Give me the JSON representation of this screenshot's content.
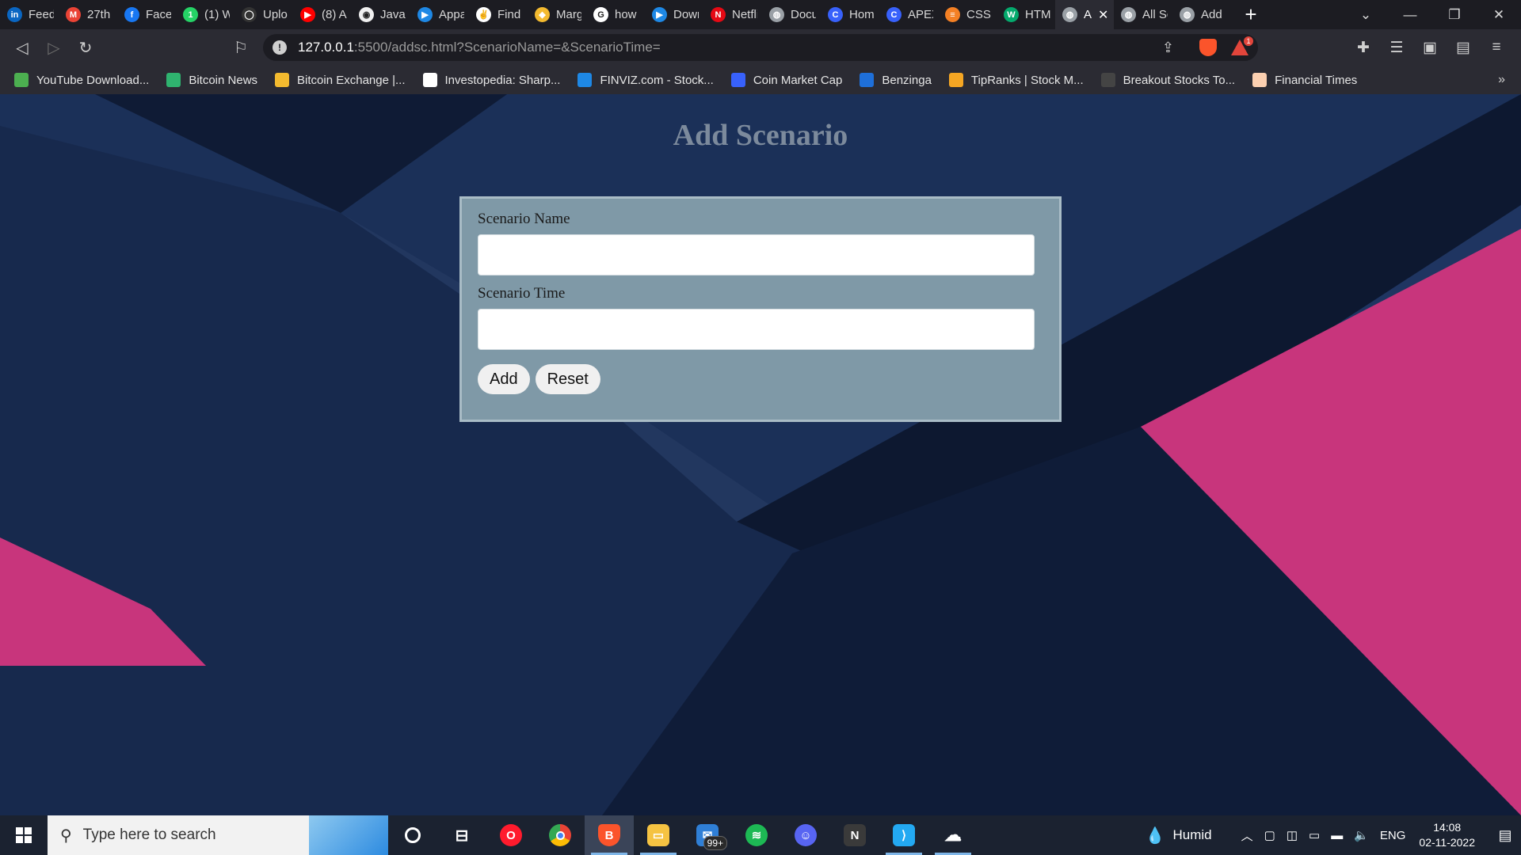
{
  "browser": {
    "tabs": [
      {
        "label": "Feed",
        "icon": "linkedin-icon",
        "color": "#0a66c2",
        "glyph": "in"
      },
      {
        "label": "27th",
        "icon": "gmail-icon",
        "color": "#ea4335",
        "glyph": "M"
      },
      {
        "label": "Faceb",
        "icon": "facebook-icon",
        "color": "#1877f2",
        "glyph": "f"
      },
      {
        "label": "(1) W",
        "icon": "whatsapp-icon",
        "color": "#25d366",
        "glyph": "1"
      },
      {
        "label": "Uplo",
        "icon": "github-icon",
        "color": "#333333",
        "glyph": "◯"
      },
      {
        "label": "(8) A",
        "icon": "youtube-icon",
        "color": "#ff0000",
        "glyph": "▶"
      },
      {
        "label": "JavaS",
        "icon": "github-icon",
        "color": "#f0f0f0",
        "glyph": "◉"
      },
      {
        "label": "Appa",
        "icon": "play-icon",
        "color": "#1e88e5",
        "glyph": "▶"
      },
      {
        "label": "Find",
        "icon": "angellist-icon",
        "color": "#ffffff",
        "glyph": "✌"
      },
      {
        "label": "Marg",
        "icon": "binance-icon",
        "color": "#f3ba2f",
        "glyph": "◆"
      },
      {
        "label": "how",
        "icon": "google-icon",
        "color": "#ffffff",
        "glyph": "G"
      },
      {
        "label": "Down",
        "icon": "play-icon",
        "color": "#1e88e5",
        "glyph": "▶"
      },
      {
        "label": "Netfli",
        "icon": "netflix-icon",
        "color": "#e50914",
        "glyph": "N"
      },
      {
        "label": "Docu",
        "icon": "globe-icon",
        "color": "#9aa0a6",
        "glyph": "◍"
      },
      {
        "label": "Hom",
        "icon": "coinmarketcap-icon",
        "color": "#3861fb",
        "glyph": "C"
      },
      {
        "label": "APEX",
        "icon": "coinmarketcap-icon",
        "color": "#3861fb",
        "glyph": "C"
      },
      {
        "label": "CSS f",
        "icon": "stackoverflow-icon",
        "color": "#f48024",
        "glyph": "≡"
      },
      {
        "label": "HTM",
        "icon": "w3schools-icon",
        "color": "#04aa6d",
        "glyph": "W"
      },
      {
        "label": "A",
        "icon": "globe-icon",
        "color": "#9aa0a6",
        "glyph": "◍",
        "active": true
      },
      {
        "label": "All Sc",
        "icon": "globe-icon",
        "color": "#9aa0a6",
        "glyph": "◍"
      },
      {
        "label": "Add",
        "icon": "globe-icon",
        "color": "#9aa0a6",
        "glyph": "◍"
      }
    ],
    "url_host": "127.0.0.1",
    "url_path": ":5500/addsc.html?ScenarioName=&ScenarioTime=",
    "bat_badge": "1",
    "bookmarks": [
      {
        "label": "YouTube Download...",
        "color": "#4caf50"
      },
      {
        "label": "Bitcoin News",
        "color": "#2fb36f"
      },
      {
        "label": "Bitcoin Exchange |...",
        "color": "#f3ba2f"
      },
      {
        "label": "Investopedia: Sharp...",
        "color": "#ffffff"
      },
      {
        "label": "FINVIZ.com - Stock...",
        "color": "#1e88e5"
      },
      {
        "label": "Coin Market Cap",
        "color": "#3861fb"
      },
      {
        "label": "Benzinga",
        "color": "#1e6fd9"
      },
      {
        "label": "TipRanks | Stock M...",
        "color": "#f5a623"
      },
      {
        "label": "Breakout Stocks To...",
        "color": "#444444"
      },
      {
        "label": "Financial Times",
        "color": "#fcd0b1"
      }
    ]
  },
  "page": {
    "title": "Add Scenario",
    "form": {
      "name_label": "Scenario Name",
      "name_value": "",
      "time_label": "Scenario Time",
      "time_value": "",
      "add_button": "Add",
      "reset_button": "Reset"
    },
    "colors": {
      "background": "#13223f",
      "accent_pink": "#c8357c",
      "panel": "#7f99a7"
    }
  },
  "taskbar": {
    "search_placeholder": "Type here to search",
    "mail_badge": "99+",
    "weather": "Humid",
    "language": "ENG",
    "time": "14:08",
    "date": "02-11-2022"
  }
}
